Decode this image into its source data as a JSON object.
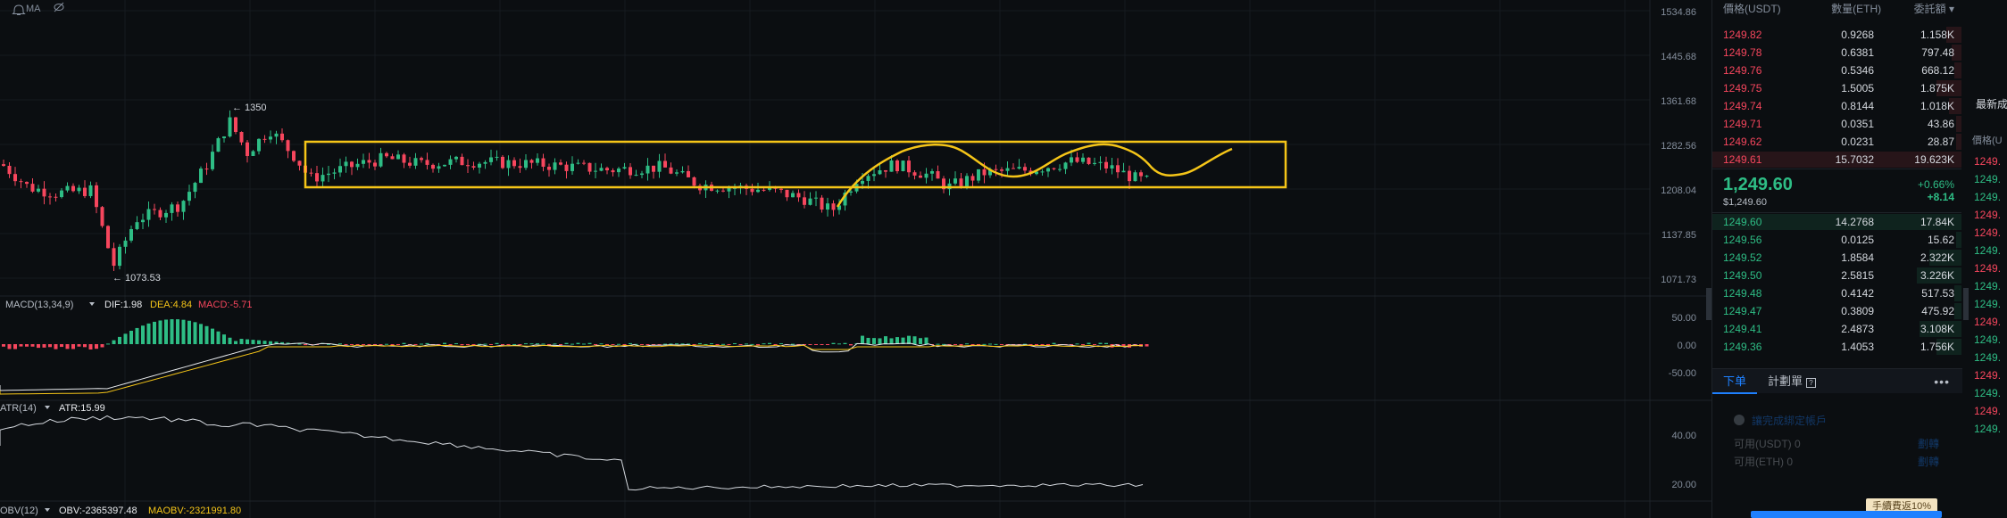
{
  "colors": {
    "up": "#2ebd85",
    "down": "#f6465d",
    "annotation": "#f5c518",
    "bg": "#0b0e11",
    "accent": "#1e80ff"
  },
  "toolbar": {
    "indicator_label": "MA",
    "bell_icon": "bell-icon",
    "hide_icon": "eye-off-icon"
  },
  "price_axis": {
    "ticks": [
      "1534.86",
      "1445.68",
      "1361.68",
      "1282.56",
      "1208.04",
      "1137.85",
      "1071.73"
    ],
    "high_label": "← 1350",
    "low_label": "← 1073.53"
  },
  "macd": {
    "name": "MACD(13,34,9)",
    "dif": "DIF:1.98",
    "dea": "DEA:4.84",
    "macd": "MACD:-5.71",
    "ticks": [
      "50.00",
      "0.00",
      "-50.00"
    ]
  },
  "atr": {
    "name": "ATR(14)",
    "value": "ATR:15.99",
    "ticks": [
      "40.00",
      "20.00"
    ]
  },
  "obv": {
    "name": "OBV(12)",
    "value": "OBV:-2365397.48",
    "ma_value": "MAOBV:-2321991.80"
  },
  "orderbook": {
    "headers": {
      "price": "價格(USDT)",
      "qty": "數量(ETH)",
      "total": "委託額"
    },
    "asks": [
      {
        "price": "1249.82",
        "qty": "0.9268",
        "total": "1.158K",
        "depth": 0.06
      },
      {
        "price": "1249.78",
        "qty": "0.6381",
        "total": "797.48",
        "depth": 0.04
      },
      {
        "price": "1249.76",
        "qty": "0.5346",
        "total": "668.12",
        "depth": 0.03
      },
      {
        "price": "1249.75",
        "qty": "1.5005",
        "total": "1.875K",
        "depth": 0.1
      },
      {
        "price": "1249.74",
        "qty": "0.8144",
        "total": "1.018K",
        "depth": 0.05
      },
      {
        "price": "1249.71",
        "qty": "0.0351",
        "total": "43.86",
        "depth": 0.01
      },
      {
        "price": "1249.62",
        "qty": "0.0231",
        "total": "28.87",
        "depth": 0.01
      },
      {
        "price": "1249.61",
        "qty": "15.7032",
        "total": "19.623K",
        "depth": 1.0
      }
    ],
    "last_price": "1,249.60",
    "last_price_sub": "$1,249.60",
    "change_pct": "+0.66%",
    "change_abs": "+8.14",
    "bids": [
      {
        "price": "1249.60",
        "qty": "14.2768",
        "total": "17.84K",
        "depth": 1.0
      },
      {
        "price": "1249.56",
        "qty": "0.0125",
        "total": "15.62",
        "depth": 0.01
      },
      {
        "price": "1249.52",
        "qty": "1.8584",
        "total": "2.322K",
        "depth": 0.13
      },
      {
        "price": "1249.50",
        "qty": "2.5815",
        "total": "3.226K",
        "depth": 0.18
      },
      {
        "price": "1249.48",
        "qty": "0.4142",
        "total": "517.53",
        "depth": 0.03
      },
      {
        "price": "1249.47",
        "qty": "0.3809",
        "total": "475.92",
        "depth": 0.03
      },
      {
        "price": "1249.41",
        "qty": "2.4873",
        "total": "3.108K",
        "depth": 0.17
      },
      {
        "price": "1249.36",
        "qty": "1.4053",
        "total": "1.756K",
        "depth": 0.1
      }
    ]
  },
  "order_panel": {
    "tab_order": "下单",
    "tab_plan": "計劃單",
    "hint": "讓完成綁定帳戶",
    "avail_usdt": "可用(USDT)",
    "avail_eth": "可用(ETH)",
    "zero": "0",
    "action": "劃轉",
    "fee_badge": "手續費返10%"
  },
  "edge_panel": {
    "title": "最新成",
    "sub": "價格(U",
    "prices": [
      "1249.",
      "1249.",
      "1249.",
      "1249.",
      "1249.",
      "1249.",
      "1249.",
      "1249.",
      "1249.",
      "1249.",
      "1249.",
      "1249.",
      "1249.",
      "1249.",
      "1249.",
      "1249."
    ],
    "colors": [
      "down",
      "up",
      "up",
      "down",
      "down",
      "up",
      "down",
      "up",
      "up",
      "down",
      "up",
      "up",
      "down",
      "up",
      "down",
      "up"
    ]
  }
}
